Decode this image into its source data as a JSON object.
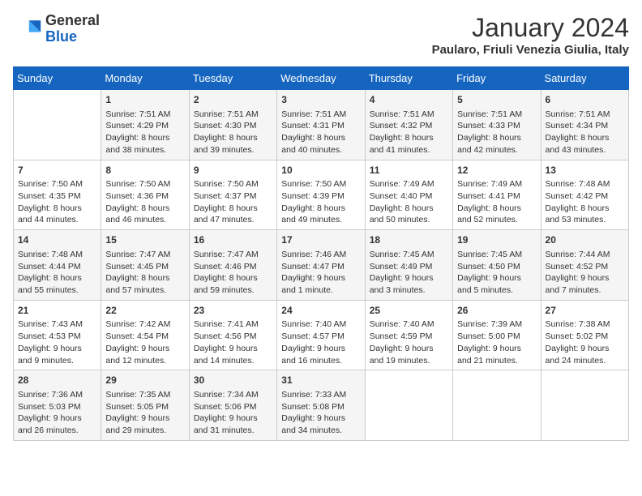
{
  "logo": {
    "general": "General",
    "blue": "Blue"
  },
  "title": "January 2024",
  "subtitle": "Paularo, Friuli Venezia Giulia, Italy",
  "days_of_week": [
    "Sunday",
    "Monday",
    "Tuesday",
    "Wednesday",
    "Thursday",
    "Friday",
    "Saturday"
  ],
  "weeks": [
    [
      {
        "num": "",
        "info": ""
      },
      {
        "num": "1",
        "info": "Sunrise: 7:51 AM\nSunset: 4:29 PM\nDaylight: 8 hours\nand 38 minutes."
      },
      {
        "num": "2",
        "info": "Sunrise: 7:51 AM\nSunset: 4:30 PM\nDaylight: 8 hours\nand 39 minutes."
      },
      {
        "num": "3",
        "info": "Sunrise: 7:51 AM\nSunset: 4:31 PM\nDaylight: 8 hours\nand 40 minutes."
      },
      {
        "num": "4",
        "info": "Sunrise: 7:51 AM\nSunset: 4:32 PM\nDaylight: 8 hours\nand 41 minutes."
      },
      {
        "num": "5",
        "info": "Sunrise: 7:51 AM\nSunset: 4:33 PM\nDaylight: 8 hours\nand 42 minutes."
      },
      {
        "num": "6",
        "info": "Sunrise: 7:51 AM\nSunset: 4:34 PM\nDaylight: 8 hours\nand 43 minutes."
      }
    ],
    [
      {
        "num": "7",
        "info": "Sunrise: 7:50 AM\nSunset: 4:35 PM\nDaylight: 8 hours\nand 44 minutes."
      },
      {
        "num": "8",
        "info": "Sunrise: 7:50 AM\nSunset: 4:36 PM\nDaylight: 8 hours\nand 46 minutes."
      },
      {
        "num": "9",
        "info": "Sunrise: 7:50 AM\nSunset: 4:37 PM\nDaylight: 8 hours\nand 47 minutes."
      },
      {
        "num": "10",
        "info": "Sunrise: 7:50 AM\nSunset: 4:39 PM\nDaylight: 8 hours\nand 49 minutes."
      },
      {
        "num": "11",
        "info": "Sunrise: 7:49 AM\nSunset: 4:40 PM\nDaylight: 8 hours\nand 50 minutes."
      },
      {
        "num": "12",
        "info": "Sunrise: 7:49 AM\nSunset: 4:41 PM\nDaylight: 8 hours\nand 52 minutes."
      },
      {
        "num": "13",
        "info": "Sunrise: 7:48 AM\nSunset: 4:42 PM\nDaylight: 8 hours\nand 53 minutes."
      }
    ],
    [
      {
        "num": "14",
        "info": "Sunrise: 7:48 AM\nSunset: 4:44 PM\nDaylight: 8 hours\nand 55 minutes."
      },
      {
        "num": "15",
        "info": "Sunrise: 7:47 AM\nSunset: 4:45 PM\nDaylight: 8 hours\nand 57 minutes."
      },
      {
        "num": "16",
        "info": "Sunrise: 7:47 AM\nSunset: 4:46 PM\nDaylight: 8 hours\nand 59 minutes."
      },
      {
        "num": "17",
        "info": "Sunrise: 7:46 AM\nSunset: 4:47 PM\nDaylight: 9 hours\nand 1 minute."
      },
      {
        "num": "18",
        "info": "Sunrise: 7:45 AM\nSunset: 4:49 PM\nDaylight: 9 hours\nand 3 minutes."
      },
      {
        "num": "19",
        "info": "Sunrise: 7:45 AM\nSunset: 4:50 PM\nDaylight: 9 hours\nand 5 minutes."
      },
      {
        "num": "20",
        "info": "Sunrise: 7:44 AM\nSunset: 4:52 PM\nDaylight: 9 hours\nand 7 minutes."
      }
    ],
    [
      {
        "num": "21",
        "info": "Sunrise: 7:43 AM\nSunset: 4:53 PM\nDaylight: 9 hours\nand 9 minutes."
      },
      {
        "num": "22",
        "info": "Sunrise: 7:42 AM\nSunset: 4:54 PM\nDaylight: 9 hours\nand 12 minutes."
      },
      {
        "num": "23",
        "info": "Sunrise: 7:41 AM\nSunset: 4:56 PM\nDaylight: 9 hours\nand 14 minutes."
      },
      {
        "num": "24",
        "info": "Sunrise: 7:40 AM\nSunset: 4:57 PM\nDaylight: 9 hours\nand 16 minutes."
      },
      {
        "num": "25",
        "info": "Sunrise: 7:40 AM\nSunset: 4:59 PM\nDaylight: 9 hours\nand 19 minutes."
      },
      {
        "num": "26",
        "info": "Sunrise: 7:39 AM\nSunset: 5:00 PM\nDaylight: 9 hours\nand 21 minutes."
      },
      {
        "num": "27",
        "info": "Sunrise: 7:38 AM\nSunset: 5:02 PM\nDaylight: 9 hours\nand 24 minutes."
      }
    ],
    [
      {
        "num": "28",
        "info": "Sunrise: 7:36 AM\nSunset: 5:03 PM\nDaylight: 9 hours\nand 26 minutes."
      },
      {
        "num": "29",
        "info": "Sunrise: 7:35 AM\nSunset: 5:05 PM\nDaylight: 9 hours\nand 29 minutes."
      },
      {
        "num": "30",
        "info": "Sunrise: 7:34 AM\nSunset: 5:06 PM\nDaylight: 9 hours\nand 31 minutes."
      },
      {
        "num": "31",
        "info": "Sunrise: 7:33 AM\nSunset: 5:08 PM\nDaylight: 9 hours\nand 34 minutes."
      },
      {
        "num": "",
        "info": ""
      },
      {
        "num": "",
        "info": ""
      },
      {
        "num": "",
        "info": ""
      }
    ]
  ]
}
